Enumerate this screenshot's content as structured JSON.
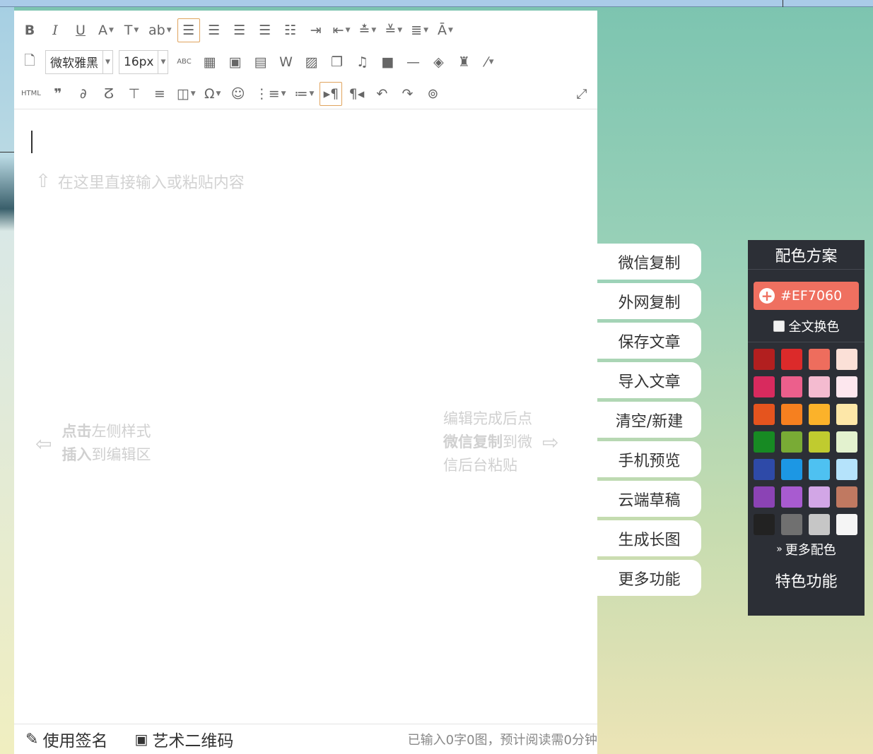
{
  "toolbar": {
    "row1": [
      {
        "name": "bold-button",
        "glyph": "B",
        "cls": "bold"
      },
      {
        "name": "italic-button",
        "glyph": "I",
        "cls": "italic"
      },
      {
        "name": "underline-button",
        "glyph": "U",
        "cls": "under"
      },
      {
        "name": "font-color-button",
        "glyph": "A",
        "caret": true
      },
      {
        "name": "font-border-button",
        "glyph": "T",
        "caret": true
      },
      {
        "name": "background-color-button",
        "glyph": "ab",
        "caret": true
      },
      {
        "name": "align-left-button",
        "glyph": "☰",
        "active": true
      },
      {
        "name": "align-center-button",
        "glyph": "☰"
      },
      {
        "name": "align-right-button",
        "glyph": "☰"
      },
      {
        "name": "align-justify-button",
        "glyph": "☰"
      },
      {
        "name": "align-middle-button",
        "glyph": "☷"
      },
      {
        "name": "indent-button",
        "glyph": "⇥"
      },
      {
        "name": "outdent-button",
        "glyph": "⇤",
        "caret": true
      },
      {
        "name": "row-spacing-top-button",
        "glyph": "≛",
        "caret": true
      },
      {
        "name": "row-spacing-bottom-button",
        "glyph": "≚",
        "caret": true
      },
      {
        "name": "line-height-button",
        "glyph": "≣",
        "caret": true
      },
      {
        "name": "letter-spacing-button",
        "glyph": "Ā",
        "caret": true
      }
    ],
    "font_family": "微软雅黑",
    "font_size": "16px",
    "row2": [
      {
        "name": "spell-check-button",
        "glyph": "ABC",
        "cls": "small"
      },
      {
        "name": "insert-table-button",
        "glyph": "▦"
      },
      {
        "name": "insert-frame-button",
        "glyph": "▣"
      },
      {
        "name": "insert-excel-button",
        "glyph": "▤"
      },
      {
        "name": "insert-word-button",
        "glyph": "W"
      },
      {
        "name": "insert-image-button",
        "glyph": "▨"
      },
      {
        "name": "insert-multi-image-button",
        "glyph": "❐"
      },
      {
        "name": "insert-music-button",
        "glyph": "♫"
      },
      {
        "name": "insert-video-button",
        "glyph": "■"
      },
      {
        "name": "horizontal-rule-button",
        "glyph": "—"
      },
      {
        "name": "clear-format-button",
        "glyph": "◈"
      },
      {
        "name": "format-brush-button",
        "glyph": "♜"
      },
      {
        "name": "magic-wand-button",
        "glyph": "⁄",
        "caret": true
      }
    ],
    "row3": [
      {
        "name": "html-source-button",
        "glyph": "HTML",
        "cls": "small"
      },
      {
        "name": "blockquote-button",
        "glyph": "❞",
        "cls": "bold"
      },
      {
        "name": "link-button",
        "glyph": "∂"
      },
      {
        "name": "unlink-button",
        "glyph": "ⵒ"
      },
      {
        "name": "page-break-button",
        "glyph": "⊤"
      },
      {
        "name": "paragraph-format-button",
        "glyph": "≡"
      },
      {
        "name": "template-button",
        "glyph": "◫",
        "caret": true
      },
      {
        "name": "special-char-button",
        "glyph": "Ω",
        "caret": true
      },
      {
        "name": "emoji-button",
        "glyph": "☺"
      },
      {
        "name": "ordered-list-button",
        "glyph": "⋮≡",
        "caret": true
      },
      {
        "name": "unordered-list-button",
        "glyph": "≔",
        "caret": true
      },
      {
        "name": "ltr-direction-button",
        "glyph": "▸¶",
        "active": true
      },
      {
        "name": "rtl-direction-button",
        "glyph": "¶◂"
      },
      {
        "name": "undo-button",
        "glyph": "↶"
      },
      {
        "name": "redo-button",
        "glyph": "↷"
      },
      {
        "name": "find-replace-button",
        "glyph": "⊚"
      }
    ],
    "fullscreen_glyph": "⤢"
  },
  "editor": {
    "hint_top": "在这里直接输入或粘贴内容",
    "hint_left_line1_bold": "点击",
    "hint_left_line1_rest": "左侧样式",
    "hint_left_line2_bold": "插入",
    "hint_left_line2_rest": "到编辑区",
    "hint_right_line1": "编辑完成后点",
    "hint_right_line2_bold": "微信复制",
    "hint_right_line2_rest": "到微",
    "hint_right_line3": "信后台粘贴"
  },
  "footer": {
    "signature_label": "使用签名",
    "qrcode_label": "艺术二维码",
    "stats": "已输入0字0图，预计阅读需0分钟"
  },
  "side_buttons": [
    "微信复制",
    "外网复制",
    "保存文章",
    "导入文章",
    "清空/新建",
    "手机预览",
    "云端草稿",
    "生成长图",
    "更多功能"
  ],
  "color_panel": {
    "title": "配色方案",
    "current_color": "#EF7060",
    "apply_all_label": "全文换色",
    "more_label": "更多配色",
    "special_label": "特色功能",
    "swatches": [
      "#b21f1f",
      "#dc2a2a",
      "#ee6d5d",
      "#fbe0d7",
      "#d82a5e",
      "#ec5f8c",
      "#f4bbd0",
      "#fde7ee",
      "#e5541e",
      "#f6801f",
      "#fbb22a",
      "#fde7a8",
      "#178a23",
      "#79ab35",
      "#c0cb2f",
      "#e3f2cf",
      "#2e4aa8",
      "#1c97e4",
      "#4ec1f1",
      "#b5e3fb",
      "#8b43b5",
      "#a85bd0",
      "#d2a6e6",
      "#c07961",
      "#222222",
      "#707070",
      "#c6c6c6",
      "#f5f5f5"
    ]
  }
}
